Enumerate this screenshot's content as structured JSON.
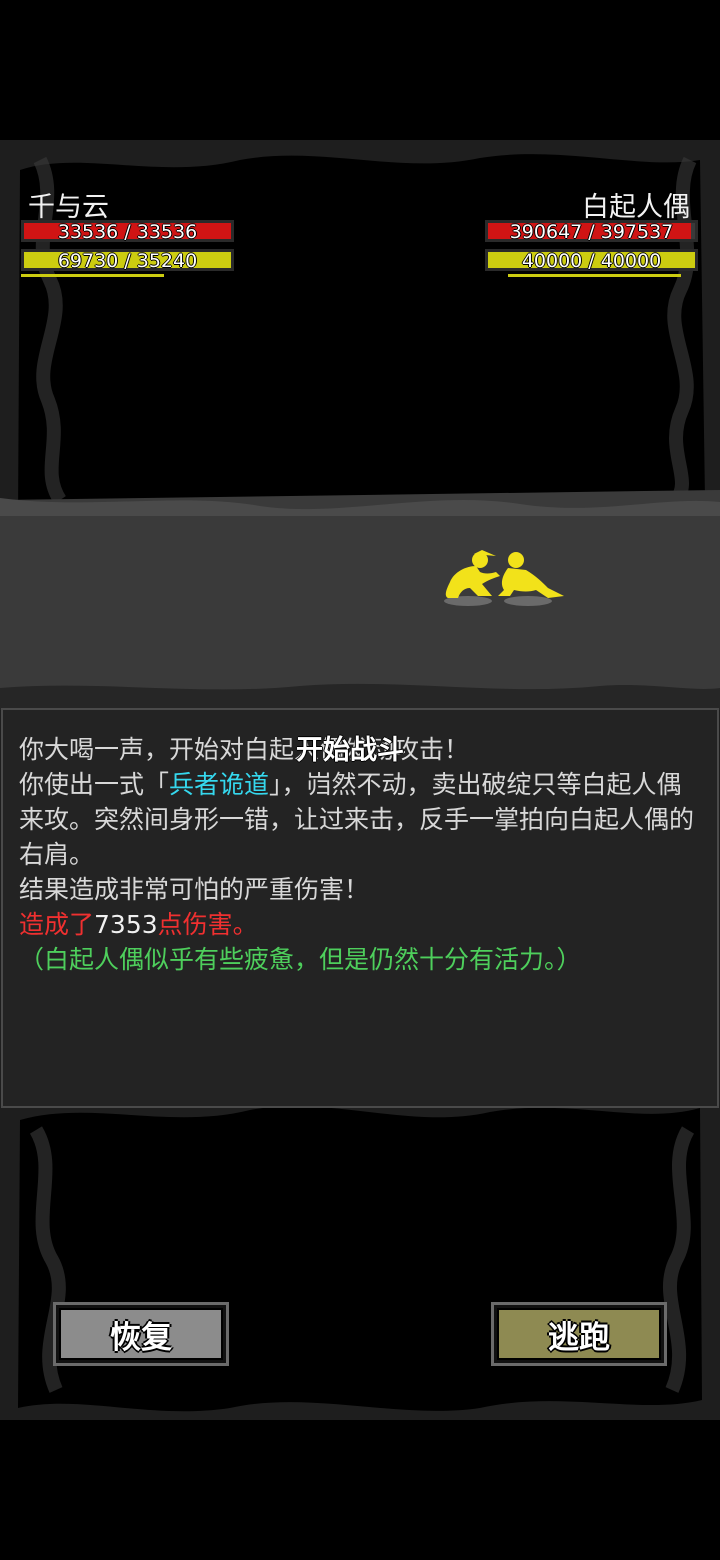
{
  "player": {
    "name": "千与云",
    "hp_text": "33536 / 33536",
    "hp_fraction": 1.0,
    "mp_text": "69730 / 35240",
    "mp_fraction": 1.0,
    "extra_bar_fraction": 0.67
  },
  "enemy": {
    "name": "白起人偶",
    "hp_text": "390647 / 397537",
    "hp_fraction": 0.983,
    "mp_text": "40000 / 40000",
    "mp_fraction": 1.0,
    "extra_bar_fraction": 0.9
  },
  "banner": "开始战斗",
  "log": {
    "line1": "你大喝一声，开始对白起人偶发动攻击！",
    "line2_prefix": "你使出一式「",
    "line2_skill": "兵者诡道",
    "line2_suffix": "」，岿然不动，卖出破绽只等白起人偶来攻。突然间身形一错，让过来击，反手一掌拍向白起人偶的右肩。",
    "line3": "结果造成非常可怕的严重伤害！",
    "damage_prefix": "造成了",
    "damage_value": "7353",
    "damage_suffix": "点伤害。",
    "status": "（白起人偶似乎有些疲惫，但是仍然十分有活力。）"
  },
  "buttons": {
    "restore": "恢复",
    "flee": "逃跑"
  },
  "colors": {
    "hp": "#d01414",
    "mp": "#cccc10",
    "skill": "#35d8ee",
    "damage": "#f03030",
    "status": "#4ecf5c",
    "figure": "#f2e21a"
  }
}
